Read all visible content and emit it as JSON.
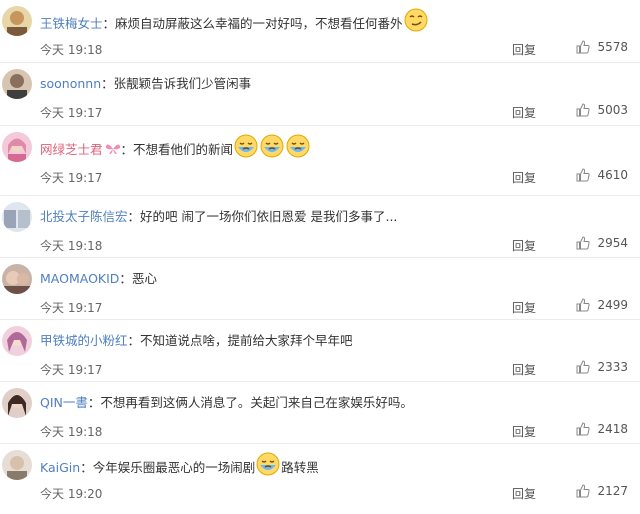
{
  "reply_label": "回复",
  "comments": [
    {
      "username": "王铁梅女士",
      "text": "麻烦自动屏蔽这么幸福的一对好吗，不想看任何番外",
      "time": "今天 19:18",
      "likes": "5578",
      "emojis": [
        "smirk-emoji"
      ],
      "avatar_color": "#d9c08a",
      "username_color": "#4f7fc0"
    },
    {
      "username": "soononnn",
      "text": "张靓颖告诉我们少管闲事",
      "time": "今天 19:17",
      "likes": "5003",
      "emojis": [],
      "avatar_color": "#8a6f5e",
      "username_color": "#4f7fc0"
    },
    {
      "username": "网绿芝士君",
      "text": "不想看他们的新闻",
      "time": "今天 19:17",
      "likes": "4610",
      "emojis": [
        "crying-emoji",
        "crying-emoji",
        "crying-emoji"
      ],
      "avatar_color": "#e8a0c0",
      "username_color": "#e0607a"
    },
    {
      "username": "北投太子陈信宏",
      "text": "好的吧 闹了一场你们依旧恩爱 是我们多事了...",
      "time": "今天 19:18",
      "likes": "2954",
      "emojis": [],
      "avatar_color": "#9aa4b8",
      "username_color": "#4f7fc0"
    },
    {
      "username": "MAOMAOKID",
      "text": "恶心",
      "time": "今天 19:17",
      "likes": "2499",
      "emojis": [],
      "avatar_color": "#a07a6a",
      "username_color": "#4f7fc0"
    },
    {
      "username": "甲铁城的小粉红",
      "text": "不知道说点啥，提前给大家拜个早年吧",
      "time": "今天 19:17",
      "likes": "2333",
      "emojis": [],
      "avatar_color": "#d68aa8",
      "username_color": "#4f7fc0"
    },
    {
      "username": "QIN一書",
      "text": "不想再看到这俩人消息了。关起门来自己在家娱乐好吗。",
      "time": "今天 19:18",
      "likes": "2418",
      "emojis": [],
      "avatar_color": "#6b4f45",
      "username_color": "#4f7fc0"
    },
    {
      "username": "KaiGin",
      "text_before": "今年娱乐圈最恶心的一场闹剧",
      "text_after": "路转黑",
      "time": "今天 19:20",
      "likes": "2127",
      "emojis": [
        "crying-emoji"
      ],
      "avatar_color": "#b8a898",
      "username_color": "#4f7fc0"
    }
  ]
}
